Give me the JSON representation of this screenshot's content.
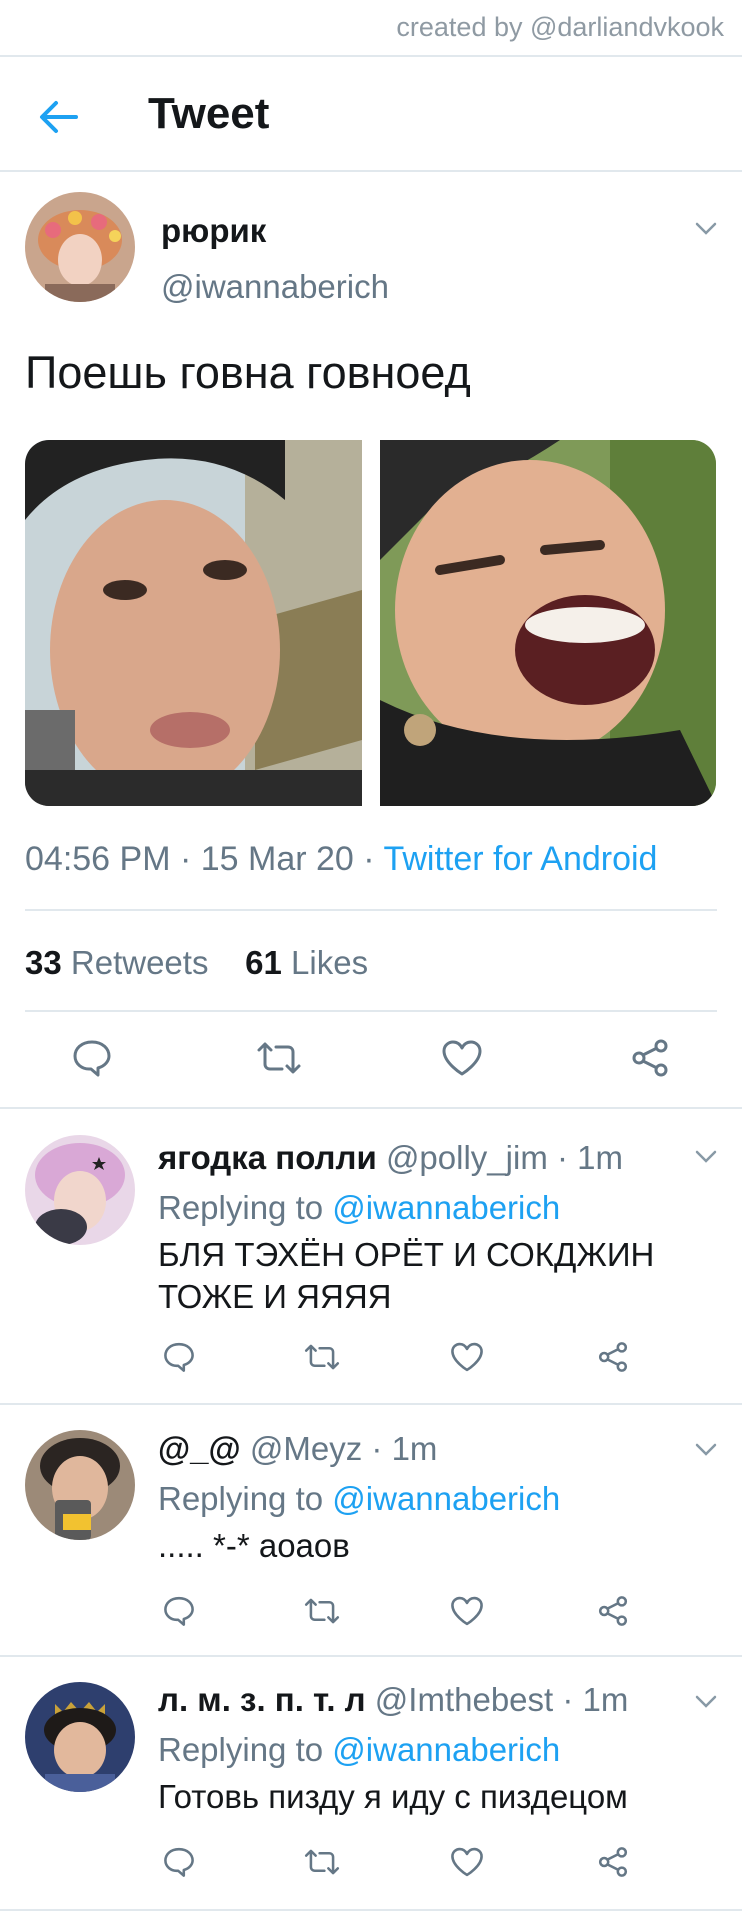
{
  "watermark": "created by @darliandvkook",
  "header": {
    "title": "Tweet"
  },
  "main_tweet": {
    "name": "рюрик",
    "handle": "@iwannaberich",
    "text": "Поешь говна говноед",
    "time": "04:56 PM",
    "sep1": " · ",
    "date": "15 Mar 20",
    "sep2": " · ",
    "source": "Twitter for Android",
    "retweets_count": "33",
    "retweets_label": "Retweets",
    "likes_count": "61",
    "likes_label": "Likes"
  },
  "replies": [
    {
      "name": "ягодка полли",
      "handle": "@polly_jim",
      "time": "1m",
      "replying_prefix": "Replying to",
      "replying_to": "@iwannaberich",
      "text": "БЛЯ ТЭХЁН ОРЁТ И СОКДЖИН ТОЖЕ И ЯЯЯЯ"
    },
    {
      "name": "@_@",
      "handle": "@Meyz",
      "time": "1m",
      "replying_prefix": "Replying to",
      "replying_to": "@iwannaberich",
      "text": "..... *-* аоаов"
    },
    {
      "name": "л. м. з. п. т. л",
      "handle": "@Imthebest",
      "time": "1m",
      "replying_prefix": "Replying to",
      "replying_to": "@iwannaberich",
      "text": "Готовь пизду я иду с пиздецом"
    }
  ],
  "colors": {
    "accent": "#1da1f2",
    "muted": "#657786",
    "divider": "#e1e8ed",
    "text": "#14171a"
  },
  "icons": {
    "back": "arrow-left-icon",
    "reply": "reply-bubble-icon",
    "retweet": "retweet-icon",
    "like": "heart-icon",
    "share": "share-icon",
    "more": "chevron-down-icon"
  }
}
